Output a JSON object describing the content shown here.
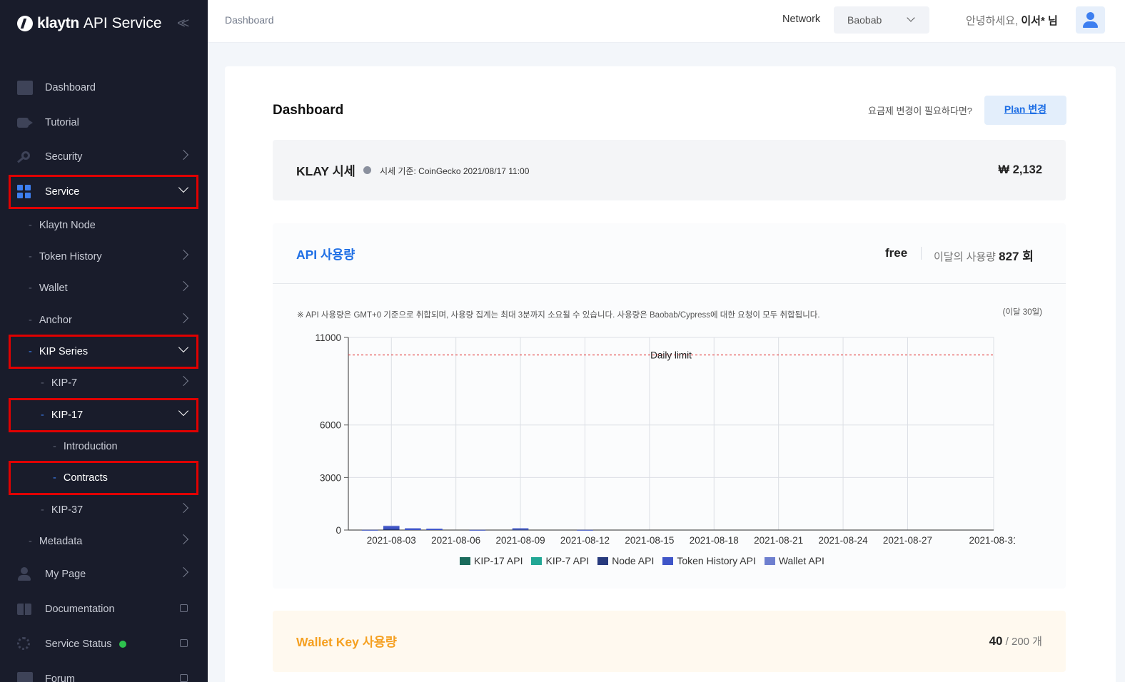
{
  "brand": {
    "word": "klaytn",
    "sub": "API Service"
  },
  "sidebar": {
    "items": [
      {
        "label": "Dashboard"
      },
      {
        "label": "Tutorial"
      },
      {
        "label": "Security"
      },
      {
        "label": "Service"
      },
      {
        "label": "Klaytn Node"
      },
      {
        "label": "Token History"
      },
      {
        "label": "Wallet"
      },
      {
        "label": "Anchor"
      },
      {
        "label": "KIP Series"
      },
      {
        "label": "KIP-7"
      },
      {
        "label": "KIP-17"
      },
      {
        "label": "Introduction"
      },
      {
        "label": "Contracts"
      },
      {
        "label": "KIP-37"
      },
      {
        "label": "Metadata"
      },
      {
        "label": "My Page"
      },
      {
        "label": "Documentation"
      },
      {
        "label": "Service Status"
      },
      {
        "label": "Forum"
      }
    ]
  },
  "header": {
    "breadcrumb": "Dashboard",
    "network_label": "Network",
    "network_value": "Baobab",
    "greeting": "안녕하세요,",
    "user_name": "이서* 님"
  },
  "main": {
    "title": "Dashboard",
    "plan_hint": "요금제 변경이 필요하다면?",
    "plan_button": "Plan 변경"
  },
  "klay": {
    "title": "KLAY 시세",
    "source": "시세 기준: CoinGecko 2021/08/17 11:00",
    "price": "₩ 2,132"
  },
  "api_usage": {
    "title": "API 사용량",
    "plan": "free",
    "usage_label": "이달의 사용량",
    "usage_value": "827 회",
    "note": "※ API 사용량은 GMT+0 기준으로 취합되며, 사용량 집계는 최대 3분까지 소요될 수 있습니다. 사용량은 Baobab/Cypress에 대한 요청이 모두 취합됩니다.",
    "range": "(이달 30일)"
  },
  "chart_data": {
    "type": "bar",
    "stacked": true,
    "x": [
      "2021-08-01",
      "2021-08-02",
      "2021-08-03",
      "2021-08-04",
      "2021-08-05",
      "2021-08-06",
      "2021-08-07",
      "2021-08-08",
      "2021-08-09",
      "2021-08-10",
      "2021-08-11",
      "2021-08-12",
      "2021-08-13",
      "2021-08-14",
      "2021-08-15",
      "2021-08-16",
      "2021-08-17",
      "2021-08-18",
      "2021-08-19",
      "2021-08-20",
      "2021-08-21",
      "2021-08-22",
      "2021-08-23",
      "2021-08-24",
      "2021-08-25",
      "2021-08-26",
      "2021-08-27",
      "2021-08-28",
      "2021-08-29",
      "2021-08-30",
      "2021-08-31"
    ],
    "x_ticks": [
      "2021-08-03",
      "2021-08-06",
      "2021-08-09",
      "2021-08-12",
      "2021-08-15",
      "2021-08-18",
      "2021-08-21",
      "2021-08-24",
      "2021-08-27",
      "2021-08-31"
    ],
    "y_ticks": [
      0,
      3000,
      6000,
      11000
    ],
    "ylim": [
      0,
      11000
    ],
    "daily_limit": {
      "label": "Daily limit",
      "value": 10000
    },
    "series": [
      {
        "name": "KIP-17 API",
        "color": "#1a6b5c",
        "values": [
          0,
          0,
          0,
          0,
          0,
          0,
          0,
          0,
          0,
          0,
          0,
          0,
          0,
          0,
          0,
          0,
          0,
          0,
          0,
          0,
          0,
          0,
          0,
          0,
          0,
          0,
          0,
          0,
          0,
          0,
          0
        ]
      },
      {
        "name": "KIP-7 API",
        "color": "#22a795",
        "values": [
          0,
          0,
          0,
          0,
          0,
          0,
          0,
          0,
          0,
          0,
          0,
          0,
          0,
          0,
          0,
          0,
          0,
          0,
          0,
          0,
          0,
          0,
          0,
          0,
          0,
          0,
          0,
          0,
          0,
          0,
          0
        ]
      },
      {
        "name": "Node API",
        "color": "#273a7d",
        "values": [
          0,
          0,
          60,
          0,
          0,
          0,
          0,
          0,
          30,
          0,
          0,
          0,
          0,
          0,
          0,
          0,
          0,
          0,
          0,
          0,
          0,
          0,
          0,
          0,
          0,
          0,
          0,
          0,
          0,
          0,
          0
        ]
      },
      {
        "name": "Token History API",
        "color": "#3f55c8",
        "values": [
          0,
          10,
          150,
          100,
          80,
          0,
          10,
          0,
          70,
          0,
          0,
          10,
          0,
          0,
          0,
          0,
          0,
          0,
          0,
          0,
          0,
          0,
          0,
          0,
          0,
          0,
          0,
          0,
          0,
          0,
          0
        ]
      },
      {
        "name": "Wallet API",
        "color": "#6e7fcf",
        "values": [
          0,
          0,
          40,
          0,
          0,
          0,
          0,
          0,
          0,
          0,
          0,
          0,
          0,
          0,
          0,
          0,
          0,
          0,
          0,
          0,
          0,
          0,
          0,
          0,
          0,
          0,
          0,
          0,
          0,
          0,
          0
        ]
      }
    ]
  },
  "wallet": {
    "title": "Wallet Key 사용량",
    "used": "40",
    "total": "/ 200 개"
  }
}
